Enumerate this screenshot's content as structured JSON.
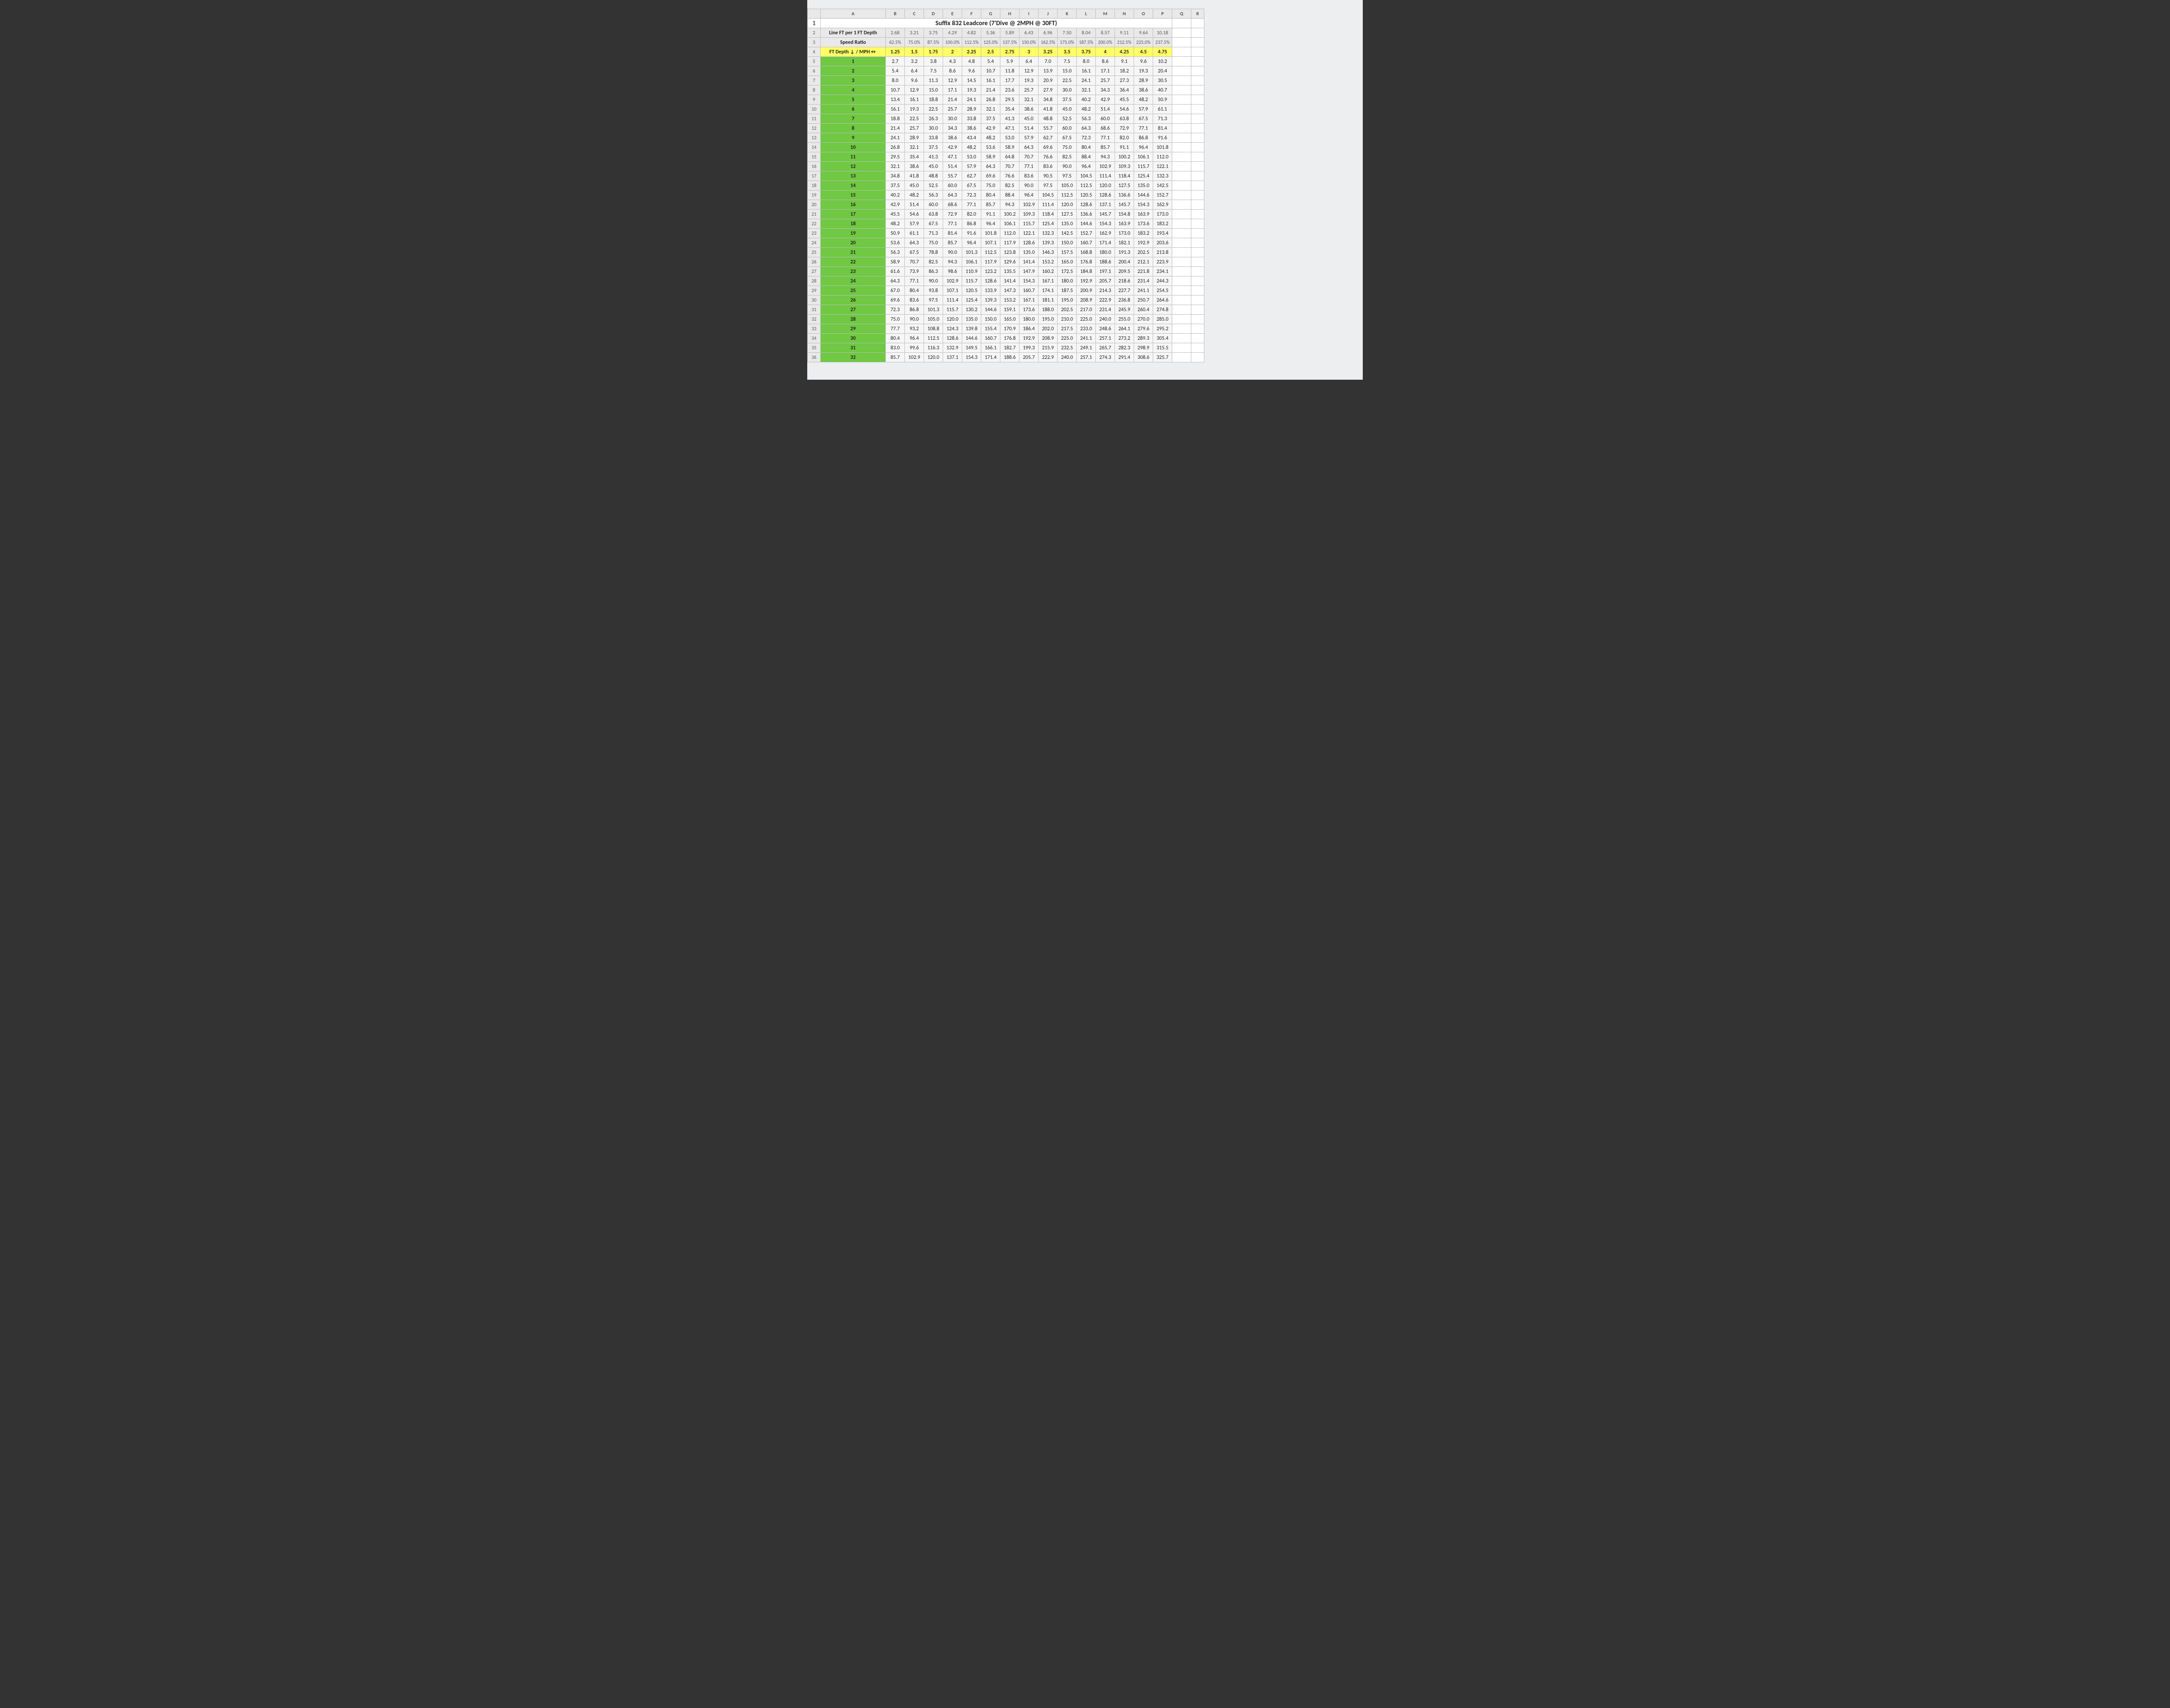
{
  "columns_letters": [
    "A",
    "B",
    "C",
    "D",
    "E",
    "F",
    "G",
    "H",
    "I",
    "J",
    "K",
    "L",
    "M",
    "N",
    "O",
    "P",
    "Q",
    "R"
  ],
  "title": "Suffix 832 Leadcore (7'Dive @ 2MPH @ 30FT)",
  "row2_label": "Line FT per 1 FT Depth",
  "row2_values": [
    "2.68",
    "3.21",
    "3.75",
    "4.29",
    "4.82",
    "5.36",
    "5.89",
    "6.43",
    "6.96",
    "7.50",
    "8.04",
    "8.57",
    "9.11",
    "9.64",
    "10.18"
  ],
  "row3_label": "Speed Ratio",
  "row3_values": [
    "62.5%",
    "75.0%",
    "87.5%",
    "100.0%",
    "112.5%",
    "125.0%",
    "137.5%",
    "150.0%",
    "162.5%",
    "175.0%",
    "187.5%",
    "200.0%",
    "212.5%",
    "225.0%",
    "237.5%"
  ],
  "row4_label": "FT Depth ↓ / MPH↔",
  "row4_values": [
    "1.25",
    "1.5",
    "1.75",
    "2",
    "2.25",
    "2.5",
    "2.75",
    "3",
    "3.25",
    "3.5",
    "3.75",
    "4",
    "4.25",
    "4.5",
    "4.75"
  ],
  "body_rows": [
    {
      "rn": "5",
      "d": "1",
      "v": [
        "2.7",
        "3.2",
        "3.8",
        "4.3",
        "4.8",
        "5.4",
        "5.9",
        "6.4",
        "7.0",
        "7.5",
        "8.0",
        "8.6",
        "9.1",
        "9.6",
        "10.2"
      ]
    },
    {
      "rn": "6",
      "d": "2",
      "v": [
        "5.4",
        "6.4",
        "7.5",
        "8.6",
        "9.6",
        "10.7",
        "11.8",
        "12.9",
        "13.9",
        "15.0",
        "16.1",
        "17.1",
        "18.2",
        "19.3",
        "20.4"
      ]
    },
    {
      "rn": "7",
      "d": "3",
      "v": [
        "8.0",
        "9.6",
        "11.3",
        "12.9",
        "14.5",
        "16.1",
        "17.7",
        "19.3",
        "20.9",
        "22.5",
        "24.1",
        "25.7",
        "27.3",
        "28.9",
        "30.5"
      ]
    },
    {
      "rn": "8",
      "d": "4",
      "v": [
        "10.7",
        "12.9",
        "15.0",
        "17.1",
        "19.3",
        "21.4",
        "23.6",
        "25.7",
        "27.9",
        "30.0",
        "32.1",
        "34.3",
        "36.4",
        "38.6",
        "40.7"
      ]
    },
    {
      "rn": "9",
      "d": "5",
      "v": [
        "13.4",
        "16.1",
        "18.8",
        "21.4",
        "24.1",
        "26.8",
        "29.5",
        "32.1",
        "34.8",
        "37.5",
        "40.2",
        "42.9",
        "45.5",
        "48.2",
        "50.9"
      ]
    },
    {
      "rn": "10",
      "d": "6",
      "v": [
        "16.1",
        "19.3",
        "22.5",
        "25.7",
        "28.9",
        "32.1",
        "35.4",
        "38.6",
        "41.8",
        "45.0",
        "48.2",
        "51.4",
        "54.6",
        "57.9",
        "61.1"
      ]
    },
    {
      "rn": "11",
      "d": "7",
      "v": [
        "18.8",
        "22.5",
        "26.3",
        "30.0",
        "33.8",
        "37.5",
        "41.3",
        "45.0",
        "48.8",
        "52.5",
        "56.3",
        "60.0",
        "63.8",
        "67.5",
        "71.3"
      ]
    },
    {
      "rn": "12",
      "d": "8",
      "v": [
        "21.4",
        "25.7",
        "30.0",
        "34.3",
        "38.6",
        "42.9",
        "47.1",
        "51.4",
        "55.7",
        "60.0",
        "64.3",
        "68.6",
        "72.9",
        "77.1",
        "81.4"
      ]
    },
    {
      "rn": "13",
      "d": "9",
      "v": [
        "24.1",
        "28.9",
        "33.8",
        "38.6",
        "43.4",
        "48.2",
        "53.0",
        "57.9",
        "62.7",
        "67.5",
        "72.3",
        "77.1",
        "82.0",
        "86.8",
        "91.6"
      ]
    },
    {
      "rn": "14",
      "d": "10",
      "v": [
        "26.8",
        "32.1",
        "37.5",
        "42.9",
        "48.2",
        "53.6",
        "58.9",
        "64.3",
        "69.6",
        "75.0",
        "80.4",
        "85.7",
        "91.1",
        "96.4",
        "101.8"
      ]
    },
    {
      "rn": "15",
      "d": "11",
      "v": [
        "29.5",
        "35.4",
        "41.3",
        "47.1",
        "53.0",
        "58.9",
        "64.8",
        "70.7",
        "76.6",
        "82.5",
        "88.4",
        "94.3",
        "100.2",
        "106.1",
        "112.0"
      ]
    },
    {
      "rn": "16",
      "d": "12",
      "v": [
        "32.1",
        "38.6",
        "45.0",
        "51.4",
        "57.9",
        "64.3",
        "70.7",
        "77.1",
        "83.6",
        "90.0",
        "96.4",
        "102.9",
        "109.3",
        "115.7",
        "122.1"
      ]
    },
    {
      "rn": "17",
      "d": "13",
      "v": [
        "34.8",
        "41.8",
        "48.8",
        "55.7",
        "62.7",
        "69.6",
        "76.6",
        "83.6",
        "90.5",
        "97.5",
        "104.5",
        "111.4",
        "118.4",
        "125.4",
        "132.3"
      ]
    },
    {
      "rn": "18",
      "d": "14",
      "v": [
        "37.5",
        "45.0",
        "52.5",
        "60.0",
        "67.5",
        "75.0",
        "82.5",
        "90.0",
        "97.5",
        "105.0",
        "112.5",
        "120.0",
        "127.5",
        "135.0",
        "142.5"
      ]
    },
    {
      "rn": "19",
      "d": "15",
      "v": [
        "40.2",
        "48.2",
        "56.3",
        "64.3",
        "72.3",
        "80.4",
        "88.4",
        "96.4",
        "104.5",
        "112.5",
        "120.5",
        "128.6",
        "136.6",
        "144.6",
        "152.7"
      ]
    },
    {
      "rn": "20",
      "d": "16",
      "v": [
        "42.9",
        "51.4",
        "60.0",
        "68.6",
        "77.1",
        "85.7",
        "94.3",
        "102.9",
        "111.4",
        "120.0",
        "128.6",
        "137.1",
        "145.7",
        "154.3",
        "162.9"
      ]
    },
    {
      "rn": "21",
      "d": "17",
      "v": [
        "45.5",
        "54.6",
        "63.8",
        "72.9",
        "82.0",
        "91.1",
        "100.2",
        "109.3",
        "118.4",
        "127.5",
        "136.6",
        "145.7",
        "154.8",
        "163.9",
        "173.0"
      ]
    },
    {
      "rn": "22",
      "d": "18",
      "v": [
        "48.2",
        "57.9",
        "67.5",
        "77.1",
        "86.8",
        "96.4",
        "106.1",
        "115.7",
        "125.4",
        "135.0",
        "144.6",
        "154.3",
        "163.9",
        "173.6",
        "183.2"
      ]
    },
    {
      "rn": "23",
      "d": "19",
      "v": [
        "50.9",
        "61.1",
        "71.3",
        "81.4",
        "91.6",
        "101.8",
        "112.0",
        "122.1",
        "132.3",
        "142.5",
        "152.7",
        "162.9",
        "173.0",
        "183.2",
        "193.4"
      ]
    },
    {
      "rn": "24",
      "d": "20",
      "v": [
        "53.6",
        "64.3",
        "75.0",
        "85.7",
        "96.4",
        "107.1",
        "117.9",
        "128.6",
        "139.3",
        "150.0",
        "160.7",
        "171.4",
        "182.1",
        "192.9",
        "203.6"
      ]
    },
    {
      "rn": "25",
      "d": "21",
      "v": [
        "56.3",
        "67.5",
        "78.8",
        "90.0",
        "101.3",
        "112.5",
        "123.8",
        "135.0",
        "146.3",
        "157.5",
        "168.8",
        "180.0",
        "191.3",
        "202.5",
        "213.8"
      ]
    },
    {
      "rn": "26",
      "d": "22",
      "v": [
        "58.9",
        "70.7",
        "82.5",
        "94.3",
        "106.1",
        "117.9",
        "129.6",
        "141.4",
        "153.2",
        "165.0",
        "176.8",
        "188.6",
        "200.4",
        "212.1",
        "223.9"
      ]
    },
    {
      "rn": "27",
      "d": "23",
      "v": [
        "61.6",
        "73.9",
        "86.3",
        "98.6",
        "110.9",
        "123.2",
        "135.5",
        "147.9",
        "160.2",
        "172.5",
        "184.8",
        "197.1",
        "209.5",
        "221.8",
        "234.1"
      ]
    },
    {
      "rn": "28",
      "d": "24",
      "v": [
        "64.3",
        "77.1",
        "90.0",
        "102.9",
        "115.7",
        "128.6",
        "141.4",
        "154.3",
        "167.1",
        "180.0",
        "192.9",
        "205.7",
        "218.6",
        "231.4",
        "244.3"
      ]
    },
    {
      "rn": "29",
      "d": "25",
      "v": [
        "67.0",
        "80.4",
        "93.8",
        "107.1",
        "120.5",
        "133.9",
        "147.3",
        "160.7",
        "174.1",
        "187.5",
        "200.9",
        "214.3",
        "227.7",
        "241.1",
        "254.5"
      ]
    },
    {
      "rn": "30",
      "d": "26",
      "v": [
        "69.6",
        "83.6",
        "97.5",
        "111.4",
        "125.4",
        "139.3",
        "153.2",
        "167.1",
        "181.1",
        "195.0",
        "208.9",
        "222.9",
        "236.8",
        "250.7",
        "264.6"
      ]
    },
    {
      "rn": "31",
      "d": "27",
      "v": [
        "72.3",
        "86.8",
        "101.3",
        "115.7",
        "130.2",
        "144.6",
        "159.1",
        "173.6",
        "188.0",
        "202.5",
        "217.0",
        "231.4",
        "245.9",
        "260.4",
        "274.8"
      ]
    },
    {
      "rn": "32",
      "d": "28",
      "v": [
        "75.0",
        "90.0",
        "105.0",
        "120.0",
        "135.0",
        "150.0",
        "165.0",
        "180.0",
        "195.0",
        "210.0",
        "225.0",
        "240.0",
        "255.0",
        "270.0",
        "285.0"
      ]
    },
    {
      "rn": "33",
      "d": "29",
      "v": [
        "77.7",
        "93.2",
        "108.8",
        "124.3",
        "139.8",
        "155.4",
        "170.9",
        "186.4",
        "202.0",
        "217.5",
        "233.0",
        "248.6",
        "264.1",
        "279.6",
        "295.2"
      ]
    },
    {
      "rn": "34",
      "d": "30",
      "v": [
        "80.4",
        "96.4",
        "112.5",
        "128.6",
        "144.6",
        "160.7",
        "176.8",
        "192.9",
        "208.9",
        "225.0",
        "241.1",
        "257.1",
        "273.2",
        "289.3",
        "305.4"
      ]
    },
    {
      "rn": "35",
      "d": "31",
      "v": [
        "83.0",
        "99.6",
        "116.3",
        "132.9",
        "149.5",
        "166.1",
        "182.7",
        "199.3",
        "215.9",
        "232.5",
        "249.1",
        "265.7",
        "282.3",
        "298.9",
        "315.5"
      ]
    },
    {
      "rn": "36",
      "d": "32",
      "v": [
        "85.7",
        "102.9",
        "120.0",
        "137.1",
        "154.3",
        "171.4",
        "188.6",
        "205.7",
        "222.9",
        "240.0",
        "257.1",
        "274.3",
        "291.4",
        "308.6",
        "325.7"
      ]
    }
  ],
  "chart_data": {
    "type": "table",
    "title": "Suffix 832 Leadcore (7'Dive @ 2MPH @ 30FT)",
    "xlabel": "MPH",
    "ylabel": "FT Depth",
    "x": [
      1.25,
      1.5,
      1.75,
      2,
      2.25,
      2.5,
      2.75,
      3,
      3.25,
      3.5,
      3.75,
      4,
      4.25,
      4.5,
      4.75
    ],
    "line_ft_per_ft_depth": [
      2.68,
      3.21,
      3.75,
      4.29,
      4.82,
      5.36,
      5.89,
      6.43,
      6.96,
      7.5,
      8.04,
      8.57,
      9.11,
      9.64,
      10.18
    ],
    "speed_ratio_pct": [
      62.5,
      75.0,
      87.5,
      100.0,
      112.5,
      125.0,
      137.5,
      150.0,
      162.5,
      175.0,
      187.5,
      200.0,
      212.5,
      225.0,
      237.5
    ],
    "depths": [
      1,
      2,
      3,
      4,
      5,
      6,
      7,
      8,
      9,
      10,
      11,
      12,
      13,
      14,
      15,
      16,
      17,
      18,
      19,
      20,
      21,
      22,
      23,
      24,
      25,
      26,
      27,
      28,
      29,
      30,
      31,
      32
    ],
    "values": [
      [
        2.7,
        3.2,
        3.8,
        4.3,
        4.8,
        5.4,
        5.9,
        6.4,
        7.0,
        7.5,
        8.0,
        8.6,
        9.1,
        9.6,
        10.2
      ],
      [
        5.4,
        6.4,
        7.5,
        8.6,
        9.6,
        10.7,
        11.8,
        12.9,
        13.9,
        15.0,
        16.1,
        17.1,
        18.2,
        19.3,
        20.4
      ],
      [
        8.0,
        9.6,
        11.3,
        12.9,
        14.5,
        16.1,
        17.7,
        19.3,
        20.9,
        22.5,
        24.1,
        25.7,
        27.3,
        28.9,
        30.5
      ],
      [
        10.7,
        12.9,
        15.0,
        17.1,
        19.3,
        21.4,
        23.6,
        25.7,
        27.9,
        30.0,
        32.1,
        34.3,
        36.4,
        38.6,
        40.7
      ],
      [
        13.4,
        16.1,
        18.8,
        21.4,
        24.1,
        26.8,
        29.5,
        32.1,
        34.8,
        37.5,
        40.2,
        42.9,
        45.5,
        48.2,
        50.9
      ],
      [
        16.1,
        19.3,
        22.5,
        25.7,
        28.9,
        32.1,
        35.4,
        38.6,
        41.8,
        45.0,
        48.2,
        51.4,
        54.6,
        57.9,
        61.1
      ],
      [
        18.8,
        22.5,
        26.3,
        30.0,
        33.8,
        37.5,
        41.3,
        45.0,
        48.8,
        52.5,
        56.3,
        60.0,
        63.8,
        67.5,
        71.3
      ],
      [
        21.4,
        25.7,
        30.0,
        34.3,
        38.6,
        42.9,
        47.1,
        51.4,
        55.7,
        60.0,
        64.3,
        68.6,
        72.9,
        77.1,
        81.4
      ],
      [
        24.1,
        28.9,
        33.8,
        38.6,
        43.4,
        48.2,
        53.0,
        57.9,
        62.7,
        67.5,
        72.3,
        77.1,
        82.0,
        86.8,
        91.6
      ],
      [
        26.8,
        32.1,
        37.5,
        42.9,
        48.2,
        53.6,
        58.9,
        64.3,
        69.6,
        75.0,
        80.4,
        85.7,
        91.1,
        96.4,
        101.8
      ],
      [
        29.5,
        35.4,
        41.3,
        47.1,
        53.0,
        58.9,
        64.8,
        70.7,
        76.6,
        82.5,
        88.4,
        94.3,
        100.2,
        106.1,
        112.0
      ],
      [
        32.1,
        38.6,
        45.0,
        51.4,
        57.9,
        64.3,
        70.7,
        77.1,
        83.6,
        90.0,
        96.4,
        102.9,
        109.3,
        115.7,
        122.1
      ],
      [
        34.8,
        41.8,
        48.8,
        55.7,
        62.7,
        69.6,
        76.6,
        83.6,
        90.5,
        97.5,
        104.5,
        111.4,
        118.4,
        125.4,
        132.3
      ],
      [
        37.5,
        45.0,
        52.5,
        60.0,
        67.5,
        75.0,
        82.5,
        90.0,
        97.5,
        105.0,
        112.5,
        120.0,
        127.5,
        135.0,
        142.5
      ],
      [
        40.2,
        48.2,
        56.3,
        64.3,
        72.3,
        80.4,
        88.4,
        96.4,
        104.5,
        112.5,
        120.5,
        128.6,
        136.6,
        144.6,
        152.7
      ],
      [
        42.9,
        51.4,
        60.0,
        68.6,
        77.1,
        85.7,
        94.3,
        102.9,
        111.4,
        120.0,
        128.6,
        137.1,
        145.7,
        154.3,
        162.9
      ],
      [
        45.5,
        54.6,
        63.8,
        72.9,
        82.0,
        91.1,
        100.2,
        109.3,
        118.4,
        127.5,
        136.6,
        145.7,
        154.8,
        163.9,
        173.0
      ],
      [
        48.2,
        57.9,
        67.5,
        77.1,
        86.8,
        96.4,
        106.1,
        115.7,
        125.4,
        135.0,
        144.6,
        154.3,
        163.9,
        173.6,
        183.2
      ],
      [
        50.9,
        61.1,
        71.3,
        81.4,
        91.6,
        101.8,
        112.0,
        122.1,
        132.3,
        142.5,
        152.7,
        162.9,
        173.0,
        183.2,
        193.4
      ],
      [
        53.6,
        64.3,
        75.0,
        85.7,
        96.4,
        107.1,
        117.9,
        128.6,
        139.3,
        150.0,
        160.7,
        171.4,
        182.1,
        192.9,
        203.6
      ],
      [
        56.3,
        67.5,
        78.8,
        90.0,
        101.3,
        112.5,
        123.8,
        135.0,
        146.3,
        157.5,
        168.8,
        180.0,
        191.3,
        202.5,
        213.8
      ],
      [
        58.9,
        70.7,
        82.5,
        94.3,
        106.1,
        117.9,
        129.6,
        141.4,
        153.2,
        165.0,
        176.8,
        188.6,
        200.4,
        212.1,
        223.9
      ],
      [
        61.6,
        73.9,
        86.3,
        98.6,
        110.9,
        123.2,
        135.5,
        147.9,
        160.2,
        172.5,
        184.8,
        197.1,
        209.5,
        221.8,
        234.1
      ],
      [
        64.3,
        77.1,
        90.0,
        102.9,
        115.7,
        128.6,
        141.4,
        154.3,
        167.1,
        180.0,
        192.9,
        205.7,
        218.6,
        231.4,
        244.3
      ],
      [
        67.0,
        80.4,
        93.8,
        107.1,
        120.5,
        133.9,
        147.3,
        160.7,
        174.1,
        187.5,
        200.9,
        214.3,
        227.7,
        241.1,
        254.5
      ],
      [
        69.6,
        83.6,
        97.5,
        111.4,
        125.4,
        139.3,
        153.2,
        167.1,
        181.1,
        195.0,
        208.9,
        222.9,
        236.8,
        250.7,
        264.6
      ],
      [
        72.3,
        86.8,
        101.3,
        115.7,
        130.2,
        144.6,
        159.1,
        173.6,
        188.0,
        202.5,
        217.0,
        231.4,
        245.9,
        260.4,
        274.8
      ],
      [
        75.0,
        90.0,
        105.0,
        120.0,
        135.0,
        150.0,
        165.0,
        180.0,
        195.0,
        210.0,
        225.0,
        240.0,
        255.0,
        270.0,
        285.0
      ],
      [
        77.7,
        93.2,
        108.8,
        124.3,
        139.8,
        155.4,
        170.9,
        186.4,
        202.0,
        217.5,
        233.0,
        248.6,
        264.1,
        279.6,
        295.2
      ],
      [
        80.4,
        96.4,
        112.5,
        128.6,
        144.6,
        160.7,
        176.8,
        192.9,
        208.9,
        225.0,
        241.1,
        257.1,
        273.2,
        289.3,
        305.4
      ],
      [
        83.0,
        99.6,
        116.3,
        132.9,
        149.5,
        166.1,
        182.7,
        199.3,
        215.9,
        232.5,
        249.1,
        265.7,
        282.3,
        298.9,
        315.5
      ],
      [
        85.7,
        102.9,
        120.0,
        137.1,
        154.3,
        171.4,
        188.6,
        205.7,
        222.9,
        240.0,
        257.1,
        274.3,
        291.4,
        308.6,
        325.7
      ]
    ]
  }
}
